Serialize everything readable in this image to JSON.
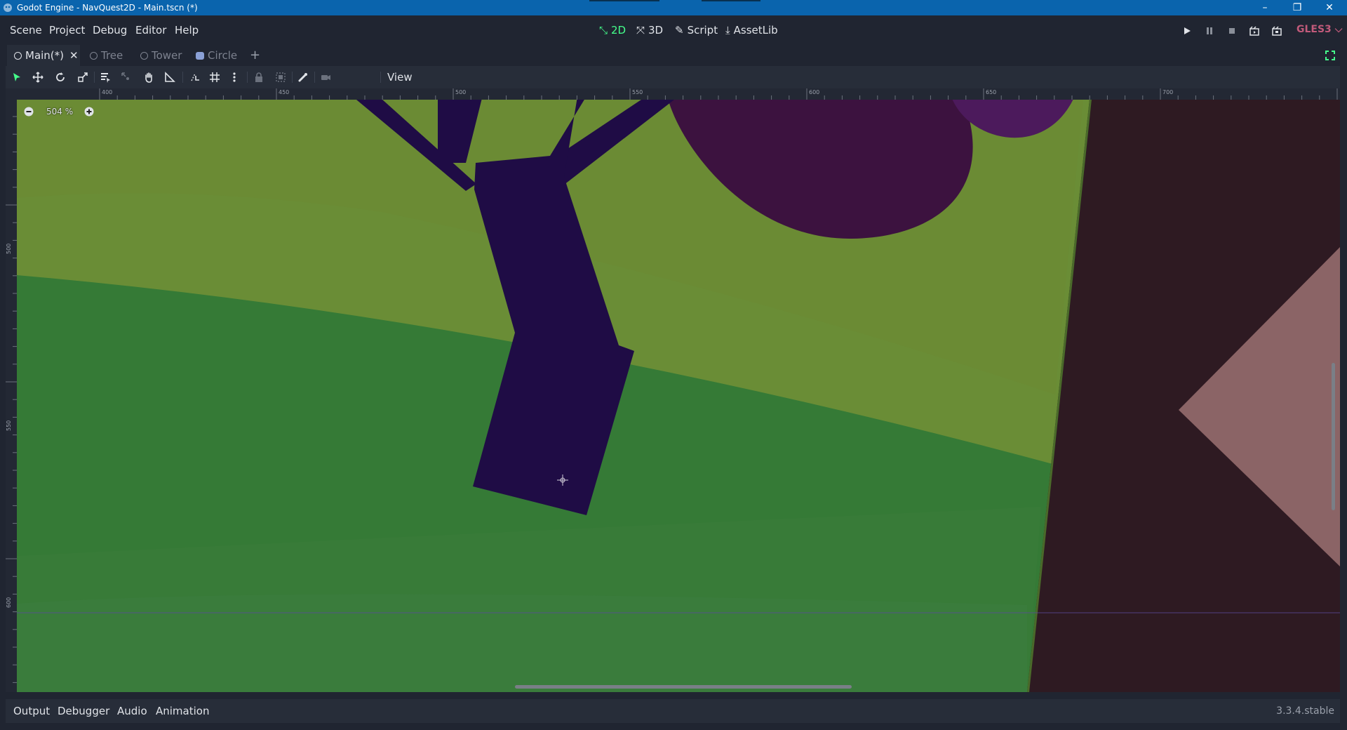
{
  "window": {
    "title": "Godot Engine - NavQuest2D - Main.tscn (*)",
    "minimize_glyph": "–",
    "restore_glyph": "❐",
    "close_glyph": "✕"
  },
  "menu": {
    "items": [
      "Scene",
      "Project",
      "Debug",
      "Editor",
      "Help"
    ]
  },
  "workspaces": [
    {
      "label": "2D",
      "icon": "2d-icon",
      "active": true
    },
    {
      "label": "3D",
      "icon": "3d-icon",
      "active": false
    },
    {
      "label": "Script",
      "icon": "script-icon",
      "active": false
    },
    {
      "label": "AssetLib",
      "icon": "assetlib-icon",
      "active": false
    }
  ],
  "renderer": {
    "label": "GLES3",
    "color": "#c15a7a"
  },
  "scene_tabs": [
    {
      "label": "Main(*)",
      "active": true,
      "icon": "scene-ring-icon"
    },
    {
      "label": "Tree",
      "active": false,
      "icon": "scene-ring-icon"
    },
    {
      "label": "Tower",
      "active": false,
      "icon": "scene-ring-icon"
    },
    {
      "label": "Circle",
      "active": false,
      "icon": "robot-icon"
    }
  ],
  "toolbar": {
    "view_label": "View",
    "tools": [
      "select-icon",
      "move-icon",
      "rotate-icon",
      "scale-icon",
      "list-select-icon",
      "pivot-icon",
      "pan-icon",
      "ruler-icon",
      "smart-snap-icon",
      "grid-snap-icon",
      "snap-options-icon",
      "lock-icon",
      "group-icon",
      "skeleton-icon",
      "override-camera-icon"
    ]
  },
  "rulers": {
    "top_labels": [
      "400",
      "450",
      "500",
      "550",
      "600",
      "650",
      "700"
    ],
    "left_labels": [
      "500",
      "550",
      "600"
    ]
  },
  "viewport": {
    "zoom_label": "504 %",
    "colors": {
      "grass_light": "#6a8d36",
      "grass_dark": "#357a36",
      "trunk": "#1f0c45",
      "foliage": "#3c123f",
      "foliage_bright": "#4c1a5c",
      "wall": "#2e1a22",
      "pink": "#8b6466"
    }
  },
  "bottom_panel": {
    "tabs": [
      "Output",
      "Debugger",
      "Audio",
      "Animation"
    ],
    "version": "3.3.4.stable"
  },
  "accent_color": "#45ff8b"
}
